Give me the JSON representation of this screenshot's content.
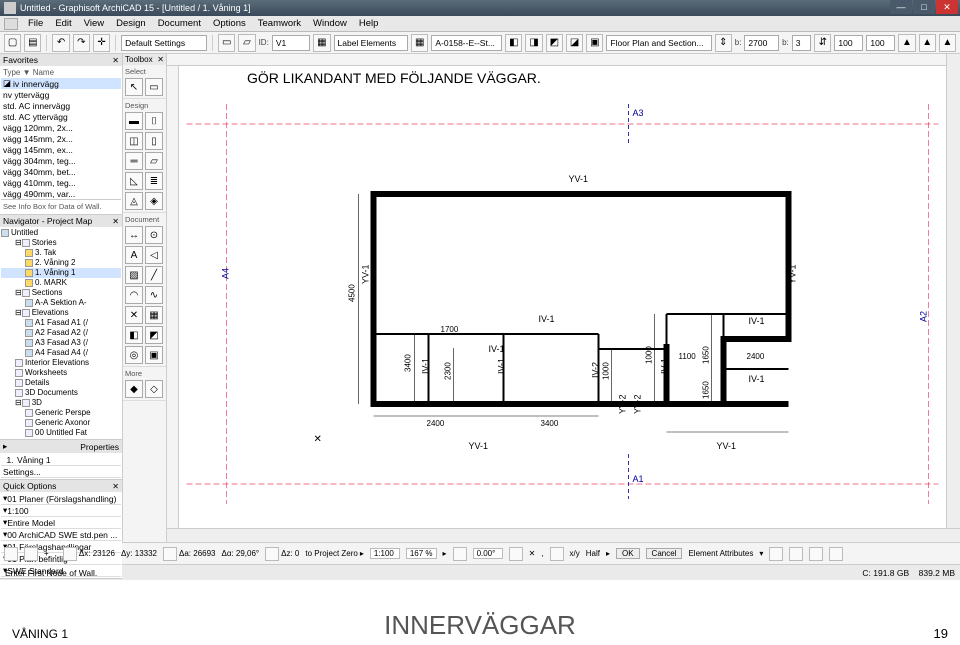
{
  "titlebar": {
    "text": "Untitled - Graphisoft ArchiCAD 15 - [Untitled / 1. Våning 1]"
  },
  "menu": {
    "items": [
      "File",
      "Edit",
      "View",
      "Design",
      "Document",
      "Options",
      "Teamwork",
      "Window",
      "Help"
    ]
  },
  "toolbar": {
    "id_lbl": "ID:",
    "id_val": "V1",
    "layer_icon": "▦",
    "layer_val": "Label Elements",
    "cut_val": "A-0158--E--St...",
    "floor_lbl": "Floor Plan and Section...",
    "dim1_lbl": "b:",
    "dim1_val": "2700",
    "dim2_lbl": "b:",
    "dim2_val": "3",
    "dim3_val": "100",
    "dim4_val": "100",
    "settings": "Default Settings"
  },
  "favorites": {
    "title": "Favorites",
    "type_hdr": "Type ▼  Name",
    "selected": "iv innervägg",
    "items": [
      "nv yttervägg",
      "std. AC innervägg",
      "std. AC yttervägg",
      "vägg 120mm, 2x...",
      "vägg 145mm, 2x...",
      "vägg 145mm, ex...",
      "vägg 304mm, teg...",
      "vägg 340mm, bet...",
      "vägg 410mm, teg...",
      "vägg 490mm, var..."
    ],
    "info": "See Info Box for Data of Wall."
  },
  "navigator": {
    "title": "Navigator - Project Map",
    "root": "Untitled",
    "stories_hdr": "Stories",
    "stories": [
      "3. Tak",
      "2. Våning 2",
      "1. Våning 1",
      "0. MARK"
    ],
    "story_sel": 2,
    "sections_hdr": "Sections",
    "sections": [
      "A-A Sektion A-"
    ],
    "elev_hdr": "Elevations",
    "elevs": [
      "A1 Fasad A1 (/",
      "A2 Fasad A2 (/",
      "A3 Fasad A3 (/",
      "A4 Fasad A4 (/"
    ],
    "rest": [
      "Interior Elevations",
      "Worksheets",
      "Details",
      "3D Documents"
    ],
    "d3_hdr": "3D",
    "d3": [
      "Generic Perspe",
      "Generic Axonor",
      "00 Untitled Fat"
    ]
  },
  "properties": {
    "title": "Properties",
    "row1_a": "1.",
    "row1_b": "Våning 1",
    "settings": "Settings..."
  },
  "quick": {
    "title": "Quick Options",
    "rows": [
      "01 Planer (Förslagshandling)",
      "1:100",
      "Entire Model",
      "00 ArchiCAD SWE std.pen ...",
      "01 Förslagshandlingar",
      "01 Plan befintlig",
      "SWE Standard"
    ]
  },
  "toolbox": {
    "title": "Toolbox",
    "sect1": "Select",
    "sect2": "Design",
    "sect3": "Document",
    "sect4": "More"
  },
  "canvas": {
    "note": "GÖR LIKANDANT MED FÖLJANDE VÄGGAR.",
    "marks": {
      "A1": "A1",
      "A2": "A2",
      "A3": "A3",
      "A4": "A4"
    },
    "wall": {
      "YV": "YV-1",
      "IV": "IV-1",
      "YV2": "YV-2",
      "IV2": "IV-2"
    },
    "dims": {
      "d4500": "4500",
      "d3400": "3400",
      "d1700": "1700",
      "d2400": "2400",
      "d2300": "2300",
      "d1000": "1000",
      "d1100": "1100",
      "d1650": "1650"
    }
  },
  "coordbar": {
    "scale": "1:100",
    "zoom": "167 %",
    "angle": "0.00°",
    "dx": "Δx: 23126",
    "dy": "Δy: 13332",
    "ax": "Δa: 26693",
    "aa": "Δα: 29,06°",
    "zx": "Δz: 0",
    "rel": "to Project Zero",
    "half": "Half",
    "ok": "OK",
    "cancel": "Cancel",
    "ea": "Element Attributes"
  },
  "statusbar": {
    "left": "Enter First Node of Wall.",
    "disk": "C: 191.8 GB",
    "mem": "839.2 MB"
  },
  "pagefooter": {
    "left": "VÅNING 1",
    "center": "INNERVÄGGAR",
    "right": "19"
  }
}
